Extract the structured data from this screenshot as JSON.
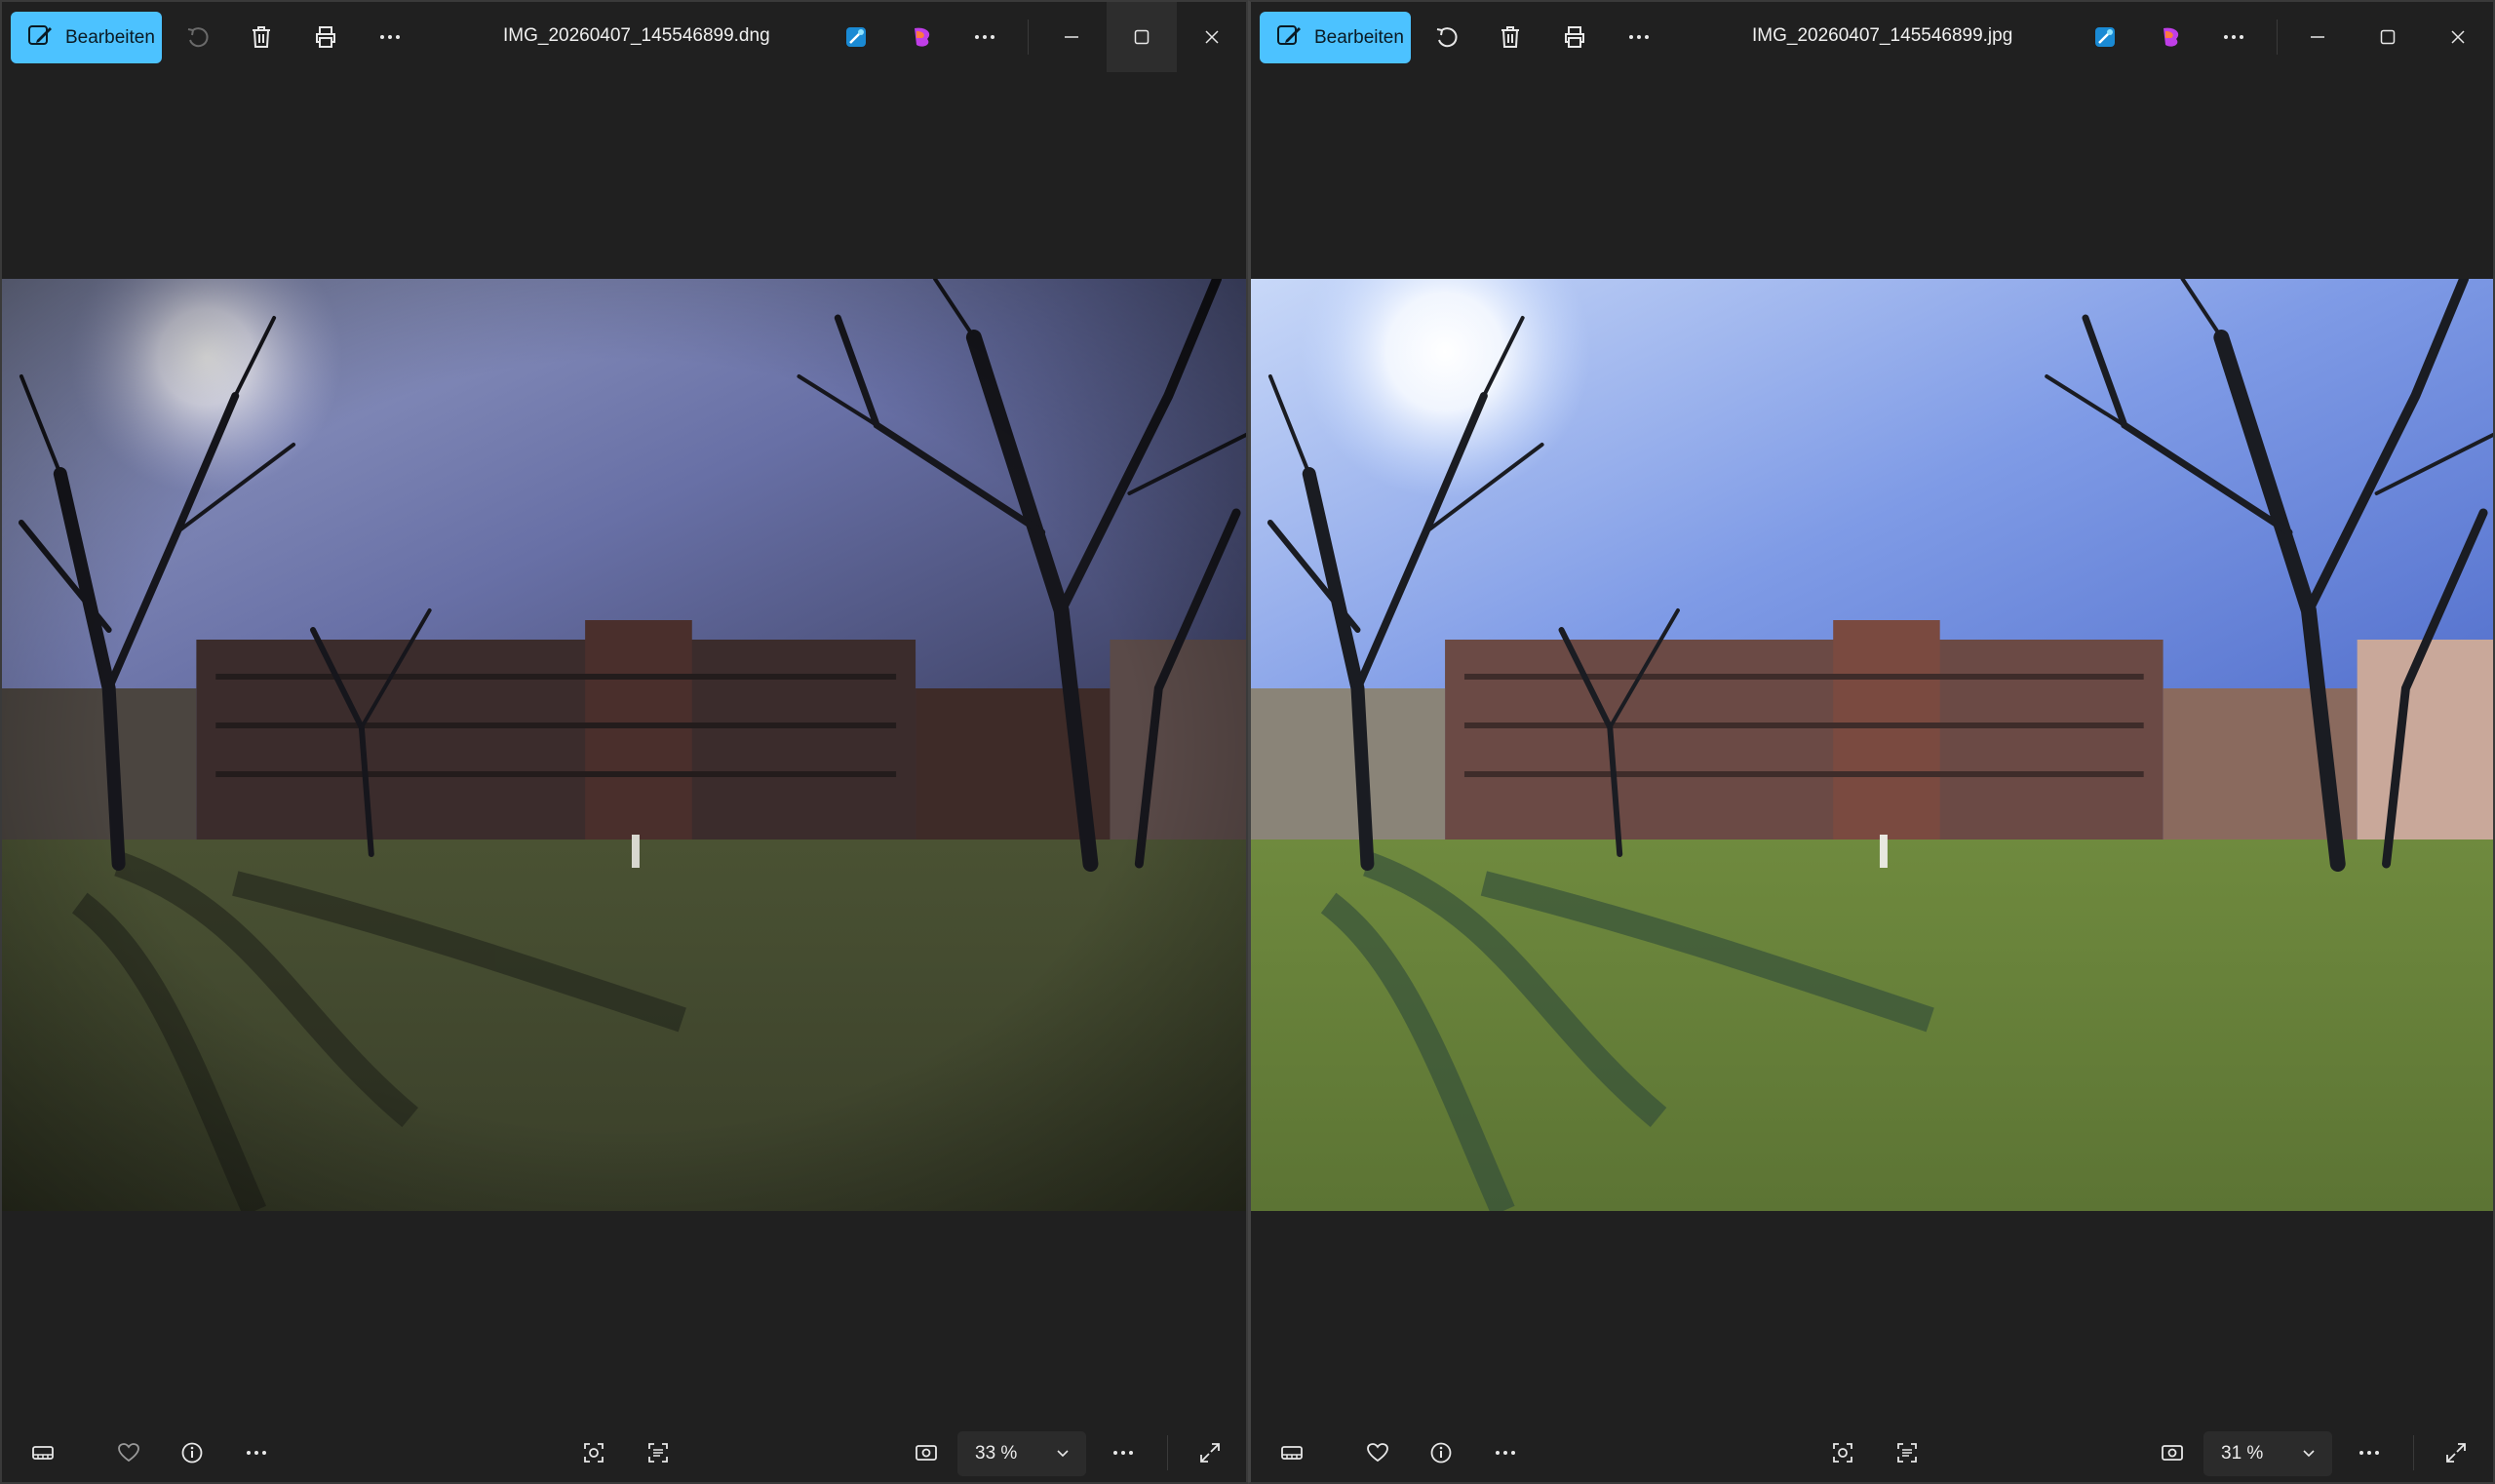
{
  "windows": [
    {
      "id": "left",
      "edit_label": "Bearbeiten",
      "title": "IMG_20260407_145546899.dng",
      "zoom_value": "33 %",
      "favorite": false,
      "rotate_enabled": false
    },
    {
      "id": "right",
      "edit_label": "Bearbeiten",
      "title": "IMG_20260407_145546899.jpg",
      "zoom_value": "31 %",
      "favorite": false,
      "rotate_enabled": true
    }
  ],
  "colors": {
    "accent": "#4cc2ff",
    "background": "#202020",
    "toolbar_button": "#2b2b2b"
  },
  "icons": {
    "titlebar": [
      "edit-icon",
      "rotate-icon",
      "delete-icon",
      "print-icon",
      "more-icon",
      "designer-icon",
      "clipchamp-icon",
      "more-icon",
      "minimize-icon",
      "maximize-icon",
      "close-icon"
    ],
    "bottombar": [
      "filmstrip-icon",
      "heart-icon",
      "info-icon",
      "more-icon",
      "visual-search-icon",
      "text-recognition-icon",
      "fit-to-window-icon",
      "chevron-down-icon",
      "more-icon",
      "fullscreen-icon"
    ]
  }
}
